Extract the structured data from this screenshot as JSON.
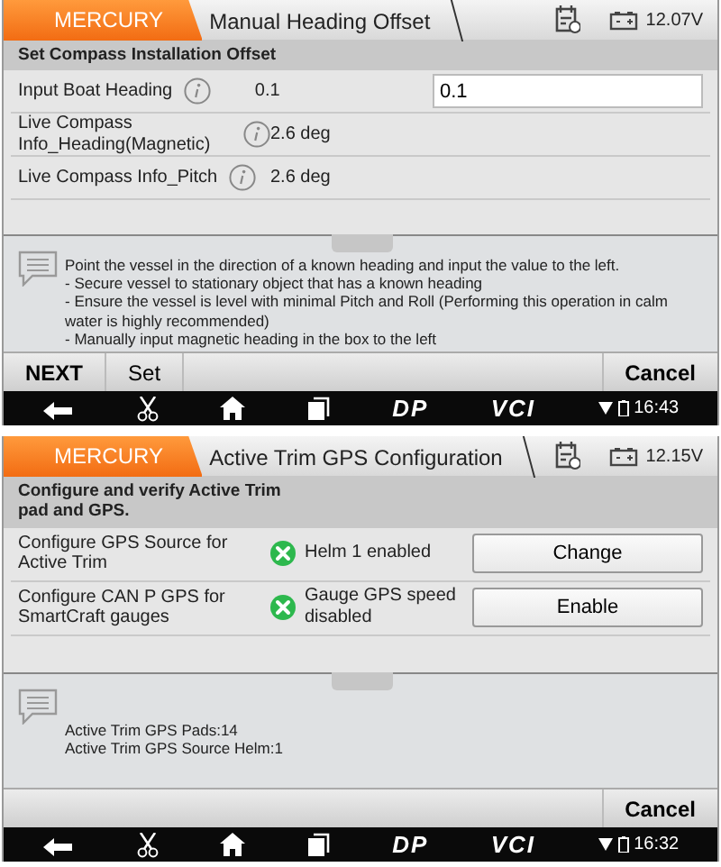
{
  "screens": [
    {
      "brand": "MERCURY",
      "title": "Manual Heading Offset",
      "voltage": "12.07V",
      "section_title": "Set Compass Installation Offset",
      "rows": [
        {
          "kind": "readout",
          "label": "Input Boat Heading",
          "value": "0.1",
          "input_value": "0.1"
        },
        {
          "kind": "readout",
          "label": "Live Compass Info_Heading(Magnetic)",
          "value": "2.6 deg"
        },
        {
          "kind": "readout",
          "label": "Live Compass Info_Pitch",
          "value": "2.6 deg"
        }
      ],
      "notes": [
        "Point the vessel in the direction of a known heading and input the value to the left.",
        "- Secure vessel to stationary object that has a known heading",
        "- Ensure the vessel is level with minimal Pitch and Roll (Performing this operation in calm water is highly recommended)",
        "- Manually input magnetic heading in the box to the left"
      ],
      "left_buttons": [
        "NEXT",
        "Set"
      ],
      "right_button": "Cancel",
      "nav": {
        "dp": "DP",
        "vci": "VCI",
        "time": "16:43"
      }
    },
    {
      "brand": "MERCURY",
      "title": "Active Trim GPS Configuration",
      "voltage": "12.15V",
      "section_title": "Configure and verify Active Trim pad and GPS.",
      "rows": [
        {
          "kind": "action",
          "label": "Configure GPS Source for Active Trim",
          "status": "Helm 1 enabled",
          "button": "Change"
        },
        {
          "kind": "action",
          "label": "Configure CAN P GPS for SmartCraft gauges",
          "status": "Gauge GPS speed disabled",
          "button": "Enable"
        }
      ],
      "notes": [
        "Active Trim GPS Pads:14",
        "Active Trim GPS Source Helm:1"
      ],
      "right_button": "Cancel",
      "nav": {
        "dp": "DP",
        "vci": "VCI",
        "time": "16:32"
      }
    }
  ]
}
